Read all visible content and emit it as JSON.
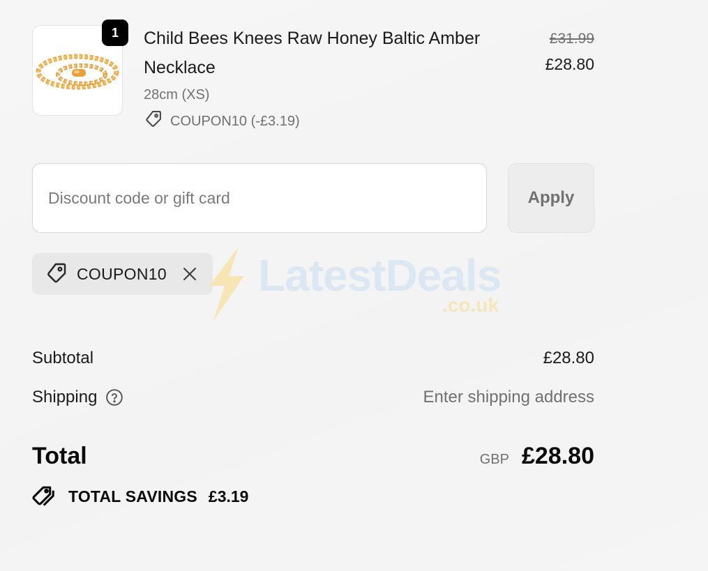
{
  "line_item": {
    "quantity": "1",
    "title": "Child Bees Knees Raw Honey Baltic Amber Necklace",
    "variant": "28cm (XS)",
    "discount": "COUPON10 (-£3.19)",
    "compare_price": "£31.99",
    "price": "£28.80",
    "image_icon": "amber-necklace-image"
  },
  "discount_form": {
    "placeholder": "Discount code or gift card",
    "value": "",
    "apply_label": "Apply"
  },
  "applied_code": {
    "code": "COUPON10",
    "icon": "tag-icon",
    "remove_icon": "close-icon"
  },
  "watermark": {
    "brand": "LatestDeals",
    "domain": ".co.uk"
  },
  "summary": {
    "subtotal_label": "Subtotal",
    "subtotal_value": "£28.80",
    "shipping_label": "Shipping",
    "shipping_value": "Enter shipping address",
    "total_label": "Total",
    "currency": "GBP",
    "total_value": "£28.80",
    "savings_label": "TOTAL SAVINGS",
    "savings_value": "£3.19"
  },
  "colors": {
    "background": "#f5f5f5",
    "text_primary": "#1a1a1a",
    "text_secondary": "#707070",
    "badge": "#000000",
    "chip_bg": "#e8e8e8"
  }
}
